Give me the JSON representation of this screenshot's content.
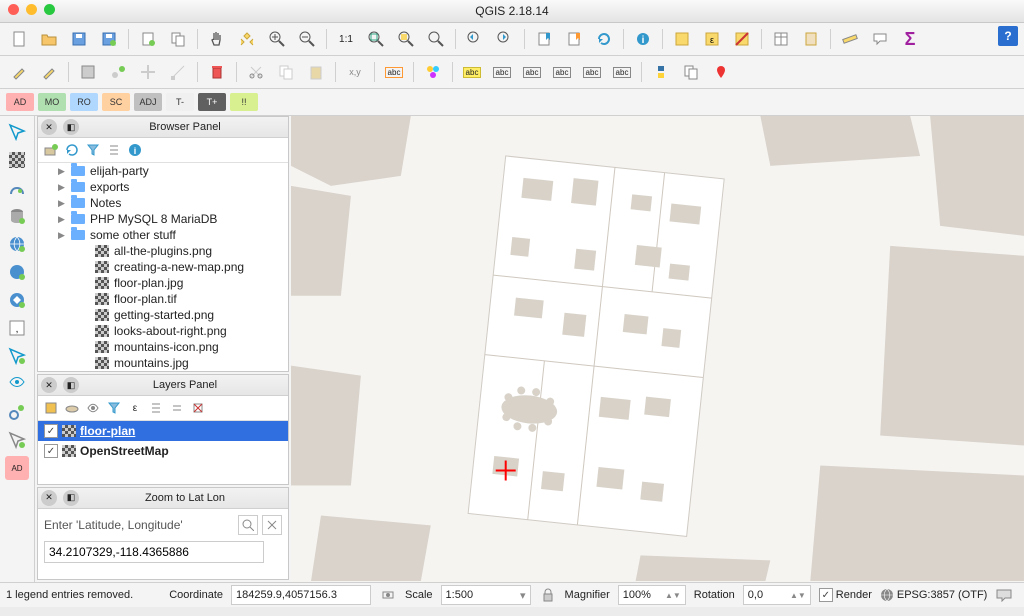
{
  "window": {
    "title": "QGIS 2.18.14"
  },
  "tags": [
    {
      "label": "AD",
      "bg": "#ffb0b0"
    },
    {
      "label": "MO",
      "bg": "#b0e0b0"
    },
    {
      "label": "RO",
      "bg": "#b0d8ff"
    },
    {
      "label": "SC",
      "bg": "#ffd0a0"
    },
    {
      "label": "ADJ",
      "bg": "#c0c0c0"
    },
    {
      "label": "T-",
      "bg": "#f0f0f0"
    },
    {
      "label": "T+",
      "bg": "#606060"
    },
    {
      "label": "!!",
      "bg": "#d8f090"
    }
  ],
  "browser": {
    "title": "Browser Panel",
    "items": [
      {
        "type": "folder",
        "name": "elijah-party",
        "expandable": true
      },
      {
        "type": "folder",
        "name": "exports",
        "expandable": true
      },
      {
        "type": "folder",
        "name": "Notes",
        "expandable": true
      },
      {
        "type": "folder",
        "name": "PHP MySQL 8 MariaDB",
        "expandable": true
      },
      {
        "type": "folder",
        "name": "some other stuff",
        "expandable": true
      },
      {
        "type": "raster",
        "name": "all-the-plugins.png"
      },
      {
        "type": "raster",
        "name": "creating-a-new-map.png"
      },
      {
        "type": "raster",
        "name": "floor-plan.jpg"
      },
      {
        "type": "raster",
        "name": "floor-plan.tif"
      },
      {
        "type": "raster",
        "name": "getting-started.png"
      },
      {
        "type": "raster",
        "name": "looks-about-right.png"
      },
      {
        "type": "raster",
        "name": "mountains-icon.png"
      },
      {
        "type": "raster",
        "name": "mountains.jpg"
      }
    ]
  },
  "layers": {
    "title": "Layers Panel",
    "items": [
      {
        "name": "floor-plan",
        "checked": true,
        "selected": true
      },
      {
        "name": "OpenStreetMap",
        "checked": true,
        "selected": false
      }
    ]
  },
  "zoom": {
    "title": "Zoom to Lat Lon",
    "placeholder": "Enter 'Latitude, Longitude'",
    "value": "34.2107329,-118.4365886"
  },
  "status": {
    "message": "1 legend entries removed.",
    "coord_label": "Coordinate",
    "coord_value": "184259.9,4057156.3",
    "scale_label": "Scale",
    "scale_value": "1:500",
    "magnifier_label": "Magnifier",
    "magnifier_value": "100%",
    "rotation_label": "Rotation",
    "rotation_value": "0,0",
    "render_label": "Render",
    "crs": "EPSG:3857 (OTF)"
  }
}
